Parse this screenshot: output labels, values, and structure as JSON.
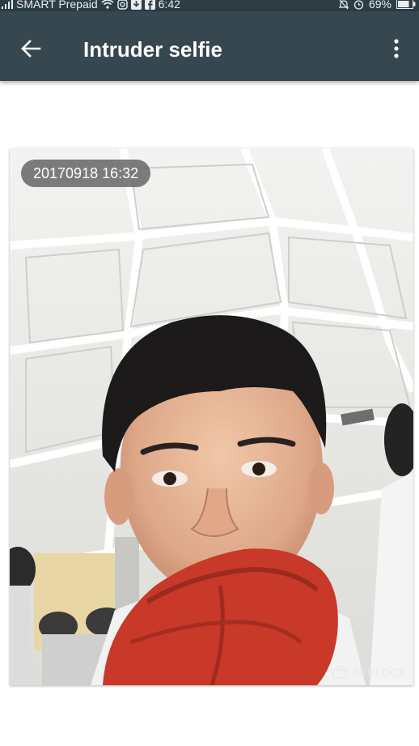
{
  "status_bar": {
    "carrier": "SMART Prepaid",
    "time": "6:42",
    "battery": "69%",
    "icons": [
      "signal-icon",
      "wifi-icon",
      "instagram-icon",
      "download-icon",
      "facebook-icon",
      "mute-icon",
      "alarm-icon",
      "battery-icon"
    ]
  },
  "app_bar": {
    "title": "Intruder selfie",
    "back_icon": "arrow-left-icon",
    "menu_icon": "more-vert-icon",
    "color": "#37474f"
  },
  "photo": {
    "timestamp": "20170918   16:32",
    "watermark": "APPLOCK",
    "watermark_icon": "applock-logo-icon"
  }
}
